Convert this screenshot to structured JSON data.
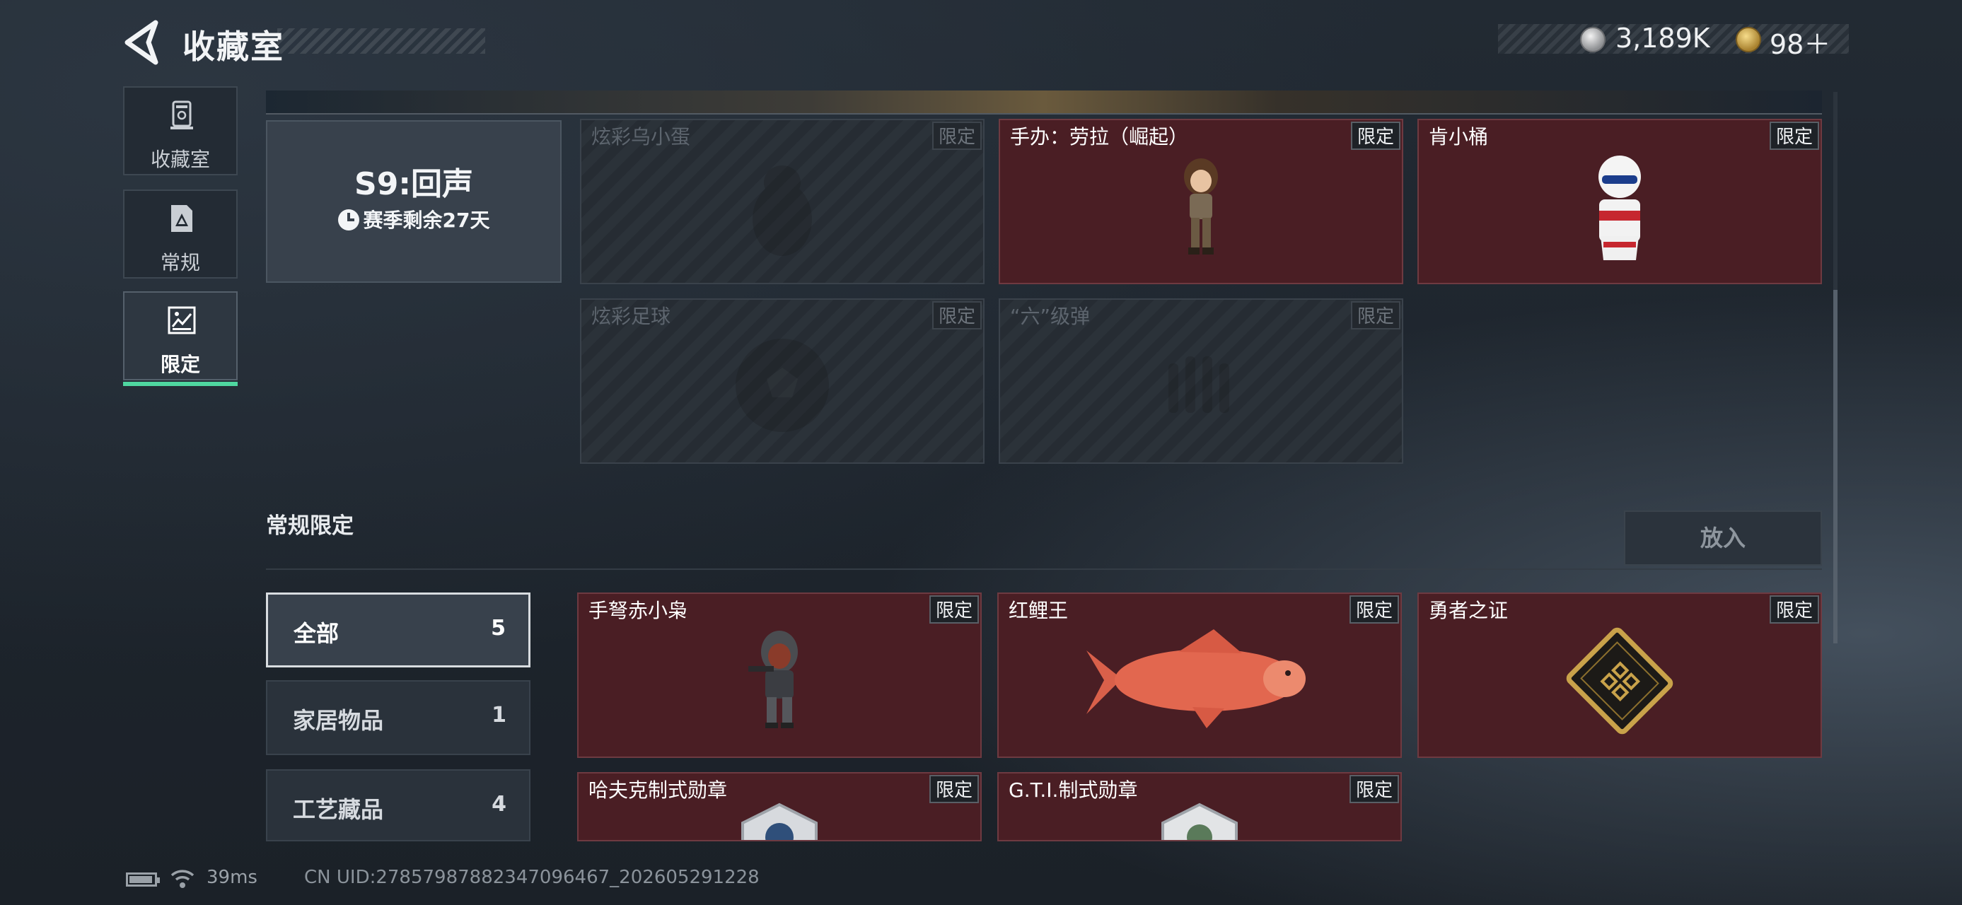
{
  "header": {
    "title": "收藏室",
    "silver_value": "3,189K",
    "gold_value": "98＋"
  },
  "sidebar": {
    "items": [
      {
        "label": "收藏室",
        "icon": "trophy-icon",
        "active": false
      },
      {
        "label": "常规",
        "icon": "document-icon",
        "active": false
      },
      {
        "label": "限定",
        "icon": "limited-icon",
        "active": true
      }
    ]
  },
  "season": {
    "title": "S9:回声",
    "remaining": "赛季剩余27天"
  },
  "season_items": [
    {
      "name": "炫彩乌小蛋",
      "tag": "限定",
      "owned": false,
      "icon": "egg-figure-icon"
    },
    {
      "name": "手办：劳拉（崛起）",
      "tag": "限定",
      "owned": true,
      "icon": "lara-figure-icon"
    },
    {
      "name": "肯小桶",
      "tag": "限定",
      "owned": true,
      "icon": "kfc-bucket-figure-icon"
    },
    {
      "name": "炫彩足球",
      "tag": "限定",
      "owned": false,
      "icon": "football-icon"
    },
    {
      "name": "“六”级弹",
      "tag": "限定",
      "owned": false,
      "icon": "bullet-icon"
    }
  ],
  "regular_section": {
    "title": "常规限定",
    "place_button": "放入"
  },
  "filters": [
    {
      "label": "全部",
      "count": "5",
      "active": true
    },
    {
      "label": "家居物品",
      "count": "1",
      "active": false
    },
    {
      "label": "工艺藏品",
      "count": "4",
      "active": false
    }
  ],
  "regular_items": [
    {
      "name": "手弩赤小枭",
      "tag": "限定",
      "owned": true,
      "icon": "crossbow-figure-icon"
    },
    {
      "name": "红鲤王",
      "tag": "限定",
      "owned": true,
      "icon": "red-carp-icon"
    },
    {
      "name": "勇者之证",
      "tag": "限定",
      "owned": true,
      "icon": "gold-card-icon"
    },
    {
      "name": "哈夫克制式勋章",
      "tag": "限定",
      "owned": true,
      "icon": "medal-icon"
    },
    {
      "name": "G.T.I.制式勋章",
      "tag": "限定",
      "owned": true,
      "icon": "gti-medal-icon"
    }
  ],
  "status": {
    "ping": "39ms",
    "uid": "CN UID:2785798788234709646​7_202605291228"
  },
  "colors": {
    "accent": "#4fd6a0",
    "owned_card": "#4a1e24",
    "background": "#1f262e"
  }
}
